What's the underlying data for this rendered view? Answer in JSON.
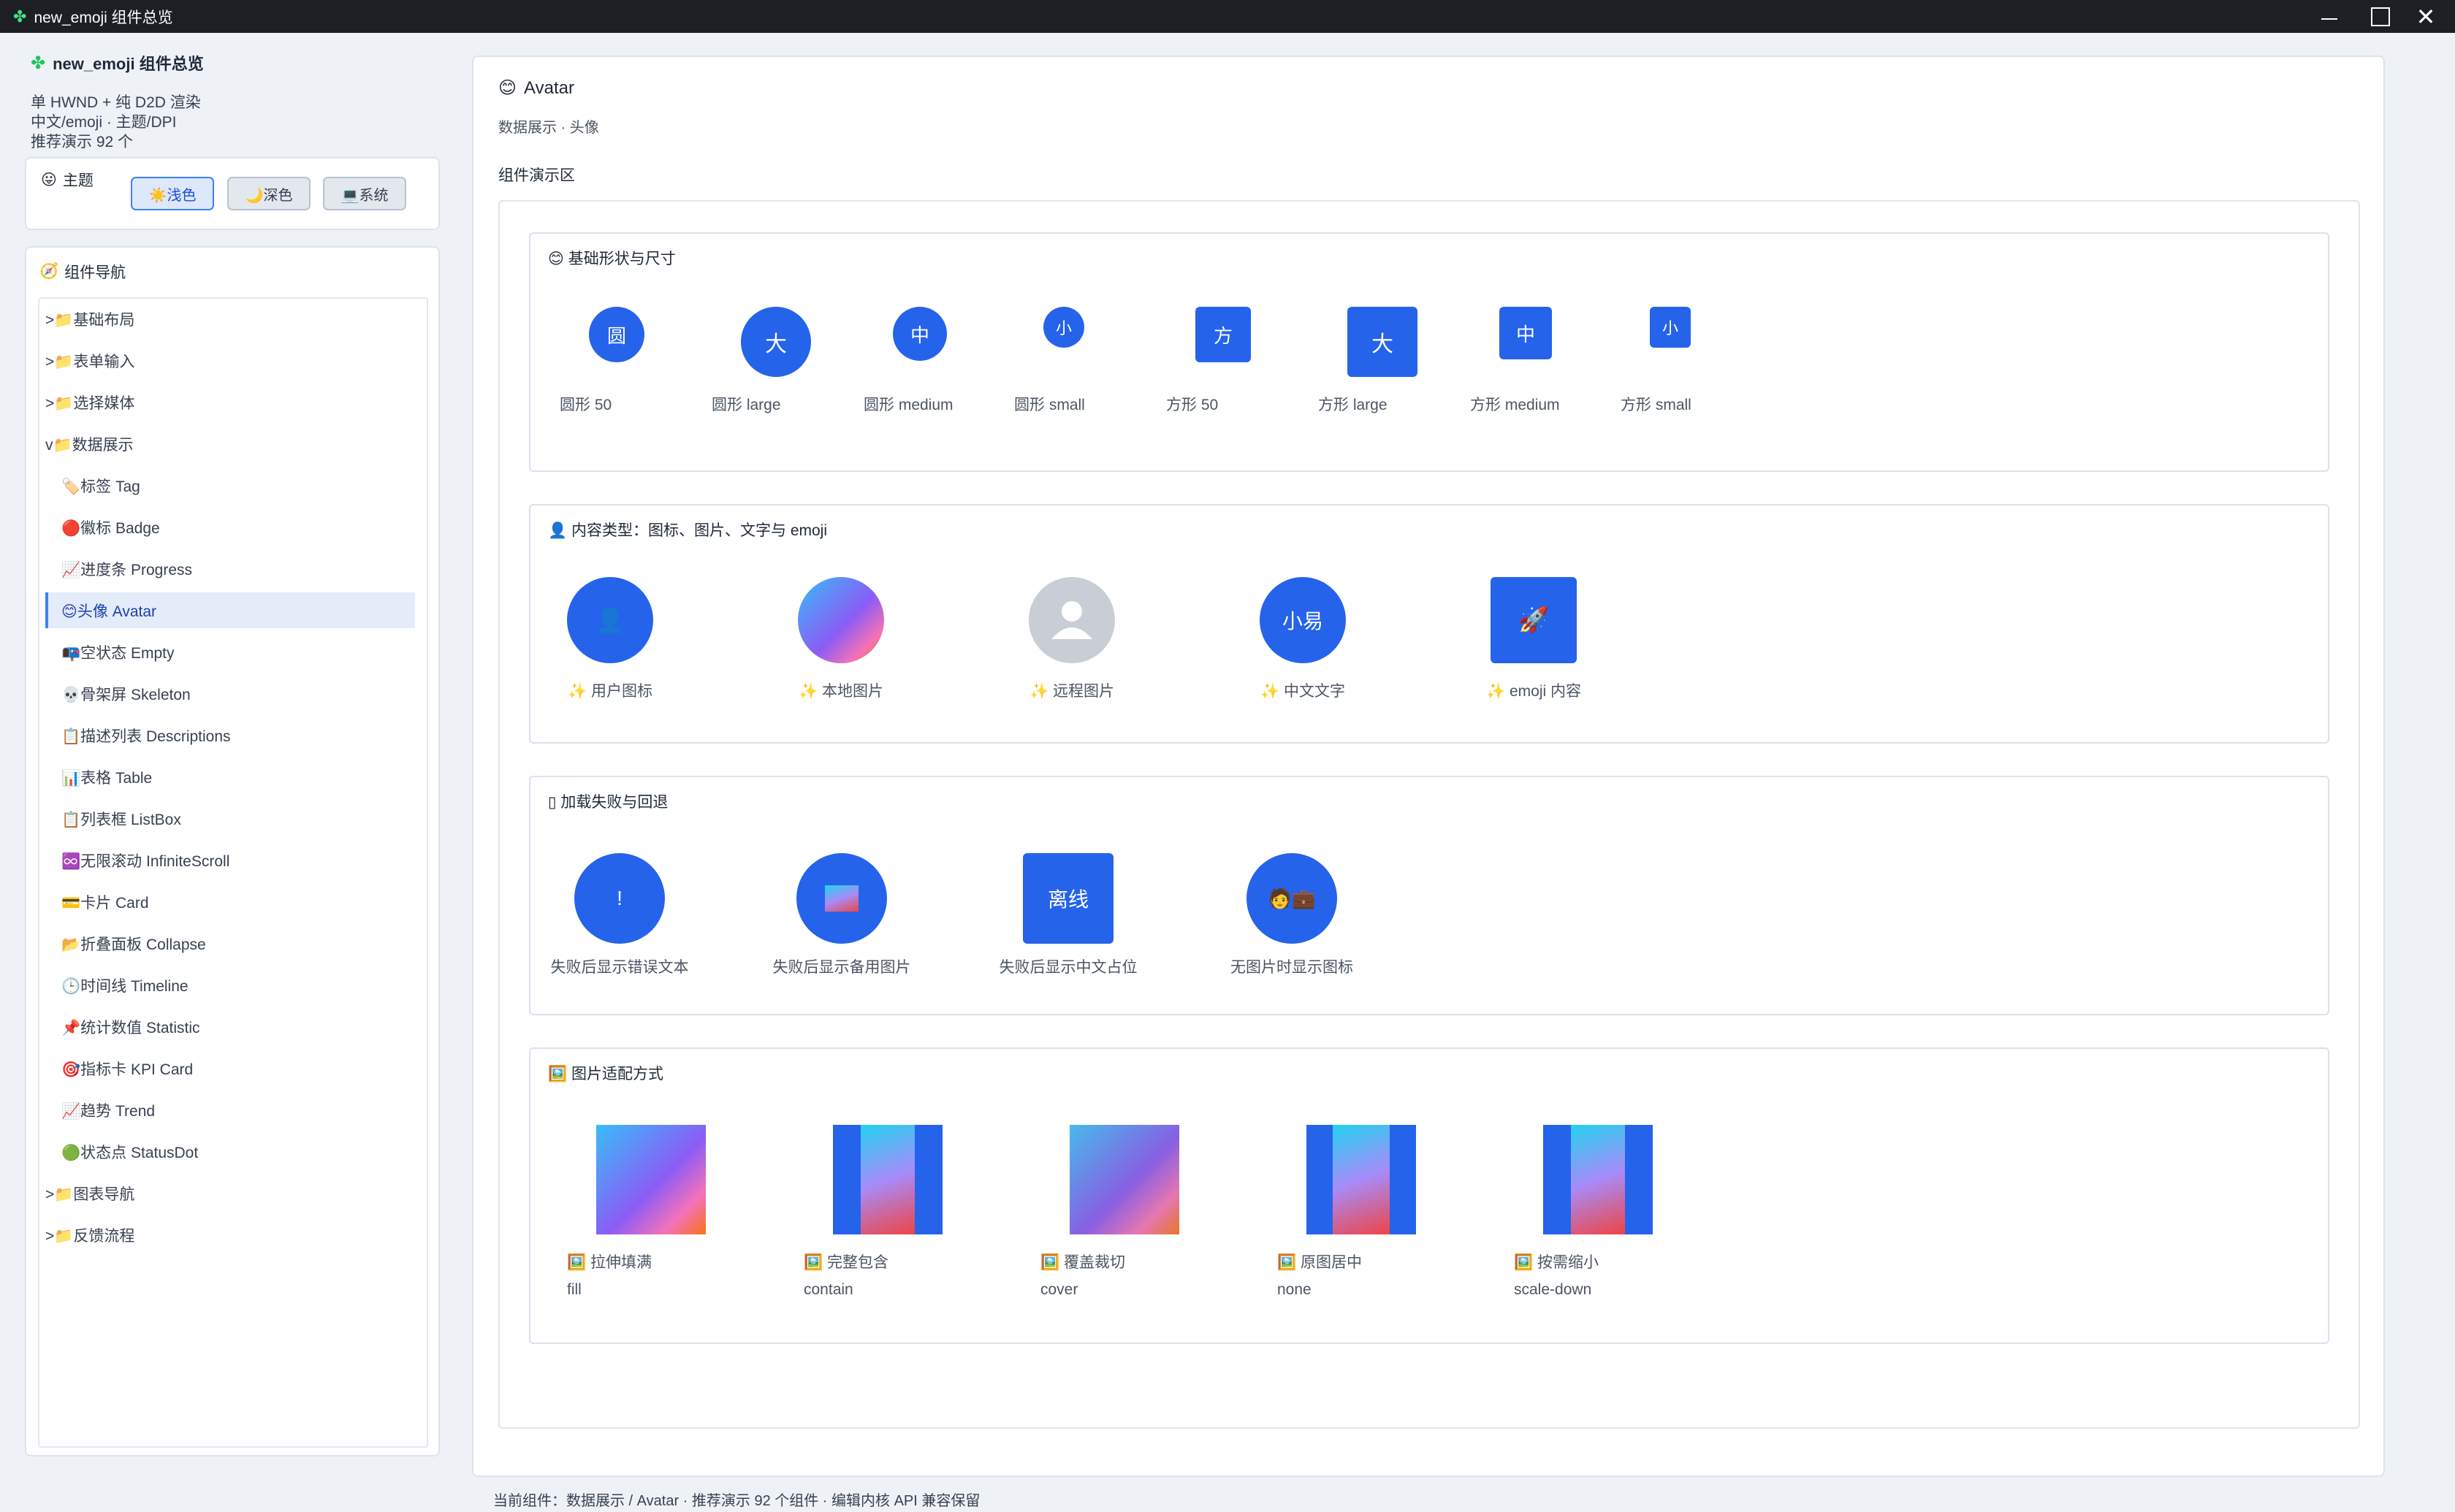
{
  "window": {
    "title": "new_emoji 组件总览",
    "icon": "puzzle-icon"
  },
  "sidebar": {
    "app_name": "new_emoji 组件总览",
    "info": [
      "单 HWND + 纯 D2D 渲染",
      "中文/emoji · 主题/DPI",
      "推荐演示 92 个"
    ],
    "theme": {
      "title": "主题",
      "buttons": [
        {
          "label": "☀️浅色",
          "active": true
        },
        {
          "label": "🌙深色",
          "active": false
        },
        {
          "label": "💻系统",
          "active": false
        }
      ]
    },
    "nav": {
      "title": "组件导航",
      "items": [
        {
          "label": ">📁基础布局"
        },
        {
          "label": ">📁表单输入"
        },
        {
          "label": ">📁选择媒体"
        },
        {
          "label": "v📁数据展示"
        },
        {
          "label": "🏷️标签 Tag"
        },
        {
          "label": "🔴徽标 Badge"
        },
        {
          "label": "📈进度条 Progress"
        },
        {
          "label": "😊头像 Avatar",
          "selected": true
        },
        {
          "label": "📭空状态 Empty"
        },
        {
          "label": "💀骨架屏 Skeleton"
        },
        {
          "label": "📋描述列表 Descriptions"
        },
        {
          "label": "📊表格 Table"
        },
        {
          "label": "📋列表框 ListBox"
        },
        {
          "label": "♾️无限滚动 InfiniteScroll"
        },
        {
          "label": "💳卡片 Card"
        },
        {
          "label": "📂折叠面板 Collapse"
        },
        {
          "label": "🕒时间线 Timeline"
        },
        {
          "label": "📌统计数值 Statistic"
        },
        {
          "label": "🎯指标卡 KPI Card"
        },
        {
          "label": "📈趋势 Trend"
        },
        {
          "label": "🟢状态点 StatusDot"
        },
        {
          "label": ">📁图表导航"
        },
        {
          "label": ">📁反馈流程"
        }
      ]
    }
  },
  "main": {
    "title": "Avatar",
    "title_icon": "😊",
    "subtitle": "数据展示 · 头像",
    "demo_label": "组件演示区",
    "sections": {
      "shapes": {
        "title": "😊 基础形状与尺寸",
        "items": [
          {
            "text": "圆",
            "caption": "圆形 50"
          },
          {
            "text": "大",
            "caption": "圆形 large"
          },
          {
            "text": "中",
            "caption": "圆形 medium"
          },
          {
            "text": "小",
            "caption": "圆形 small"
          },
          {
            "text": "方",
            "caption": "方形 50"
          },
          {
            "text": "大",
            "caption": "方形 large"
          },
          {
            "text": "中",
            "caption": "方形 medium"
          },
          {
            "text": "小",
            "caption": "方形 small"
          }
        ]
      },
      "content": {
        "title": "👤 内容类型：图标、图片、文字与 emoji",
        "items": [
          {
            "text": "👤",
            "caption": "✨ 用户图标"
          },
          {
            "text": "",
            "caption": "✨ 本地图片"
          },
          {
            "text": "",
            "caption": "✨ 远程图片"
          },
          {
            "text": "小易",
            "caption": "✨ 中文文字"
          },
          {
            "text": "🚀",
            "caption": "✨ emoji 内容"
          }
        ]
      },
      "fallback": {
        "title": "▯ 加载失败与回退",
        "items": [
          {
            "text": "!",
            "caption": "失败后显示错误文本"
          },
          {
            "text": "",
            "caption": "失败后显示备用图片"
          },
          {
            "text": "离线",
            "caption": "失败后显示中文占位"
          },
          {
            "text": "🧑💼",
            "caption": "无图片时显示图标"
          }
        ]
      },
      "fit": {
        "title": "🖼️ 图片适配方式",
        "items": [
          {
            "caption": "🖼️ 拉伸填满",
            "mode": "fill"
          },
          {
            "caption": "🖼️ 完整包含",
            "mode": "contain"
          },
          {
            "caption": "🖼️ 覆盖裁切",
            "mode": "cover"
          },
          {
            "caption": "🖼️ 原图居中",
            "mode": "none"
          },
          {
            "caption": "🖼️ 按需缩小",
            "mode": "scale-down"
          }
        ]
      }
    }
  },
  "status": "当前组件：数据展示 / Avatar · 推荐演示 92 个组件 · 编辑内核 API 兼容保留",
  "colors": {
    "accent": "#2563eb",
    "selected_bg": "#e4ecfa"
  }
}
